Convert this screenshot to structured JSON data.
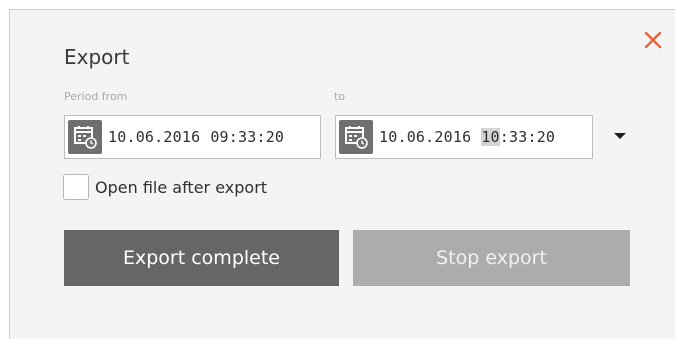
{
  "dialog": {
    "title": "Export",
    "close_icon": "close-icon",
    "accent_color": "#e8643c"
  },
  "period": {
    "from_label": "Period from",
    "to_label": "to",
    "from": {
      "date": "10.06.2016",
      "time": "09:33:20"
    },
    "to": {
      "date": "10.06.2016",
      "time_selected_part": "10",
      "time_rest": ":33:20"
    },
    "calendar_icon": "calendar-clock-icon",
    "dropdown_icon": "caret-down-icon"
  },
  "options": {
    "open_after_export_label": "Open file after export",
    "open_after_export_checked": false
  },
  "buttons": {
    "export_complete_label": "Export complete",
    "stop_export_label": "Stop export",
    "stop_export_enabled": false
  }
}
